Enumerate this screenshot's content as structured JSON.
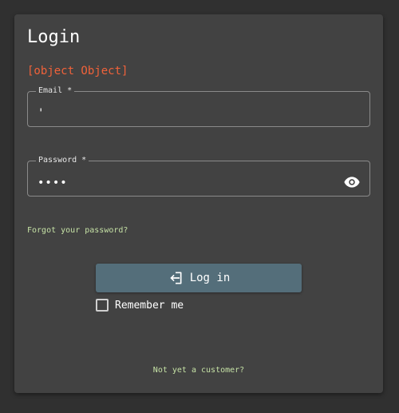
{
  "title": "Login",
  "error_message": "[object Object]",
  "email": {
    "label": "Email *",
    "value": "'"
  },
  "password": {
    "label": "Password *",
    "value": "••••",
    "toggle_icon": "eye-icon"
  },
  "forgot_password": "Forgot your password?",
  "login_button": {
    "label": "Log in",
    "icon": "login-icon"
  },
  "remember_me": {
    "label": "Remember me",
    "checked": false
  },
  "signup_link": "Not yet a customer?",
  "colors": {
    "background": "#303030",
    "card": "#424242",
    "error": "#f0623a",
    "link": "#c5e1a5",
    "button": "#546e7a"
  }
}
